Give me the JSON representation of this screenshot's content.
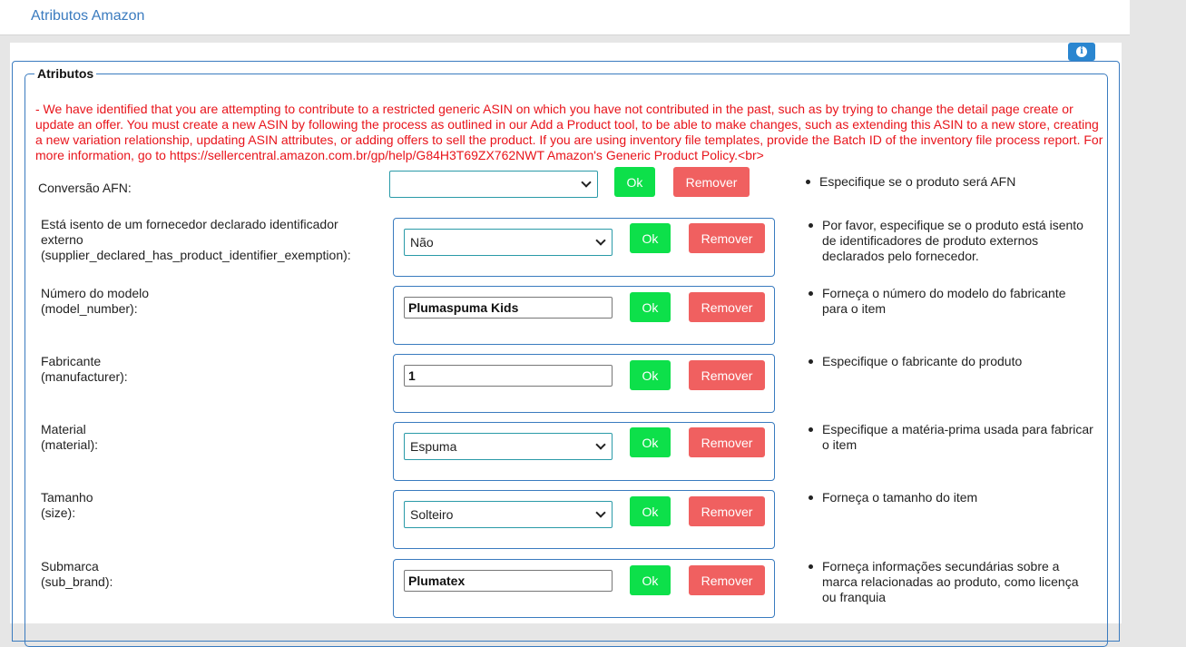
{
  "header": {
    "title": "Atributos Amazon"
  },
  "icons": {
    "info": "info-icon",
    "dropdown": "chevron-down-icon"
  },
  "colors": {
    "accent": "#3a7bbf",
    "error": "#e8141b",
    "ok": "#0de04a",
    "remove": "#f06060"
  },
  "attributes": {
    "legend": "Atributos",
    "error_message": "- We have identified that you are attempting to contribute to a restricted generic ASIN on which you have not contributed in the past, such as by trying to change the detail page create or update an offer. You must create a new ASIN by following the process as outlined in our Add a Product tool, to be able to make changes, such as extending this ASIN to a new store, creating a new variation relationship, updating ASIN attributes, or adding offers to sell the product. If you are using inventory file templates, provide the Batch ID of the inventory file process report. For more information, go to https://sellercentral.amazon.com.br/gp/help/G84H3T69ZX762NWT Amazon's Generic Product Policy.<br>",
    "ok_label": "Ok",
    "remove_label": "Remover",
    "rows": [
      {
        "label": "Conversão AFN:",
        "label_code": "",
        "type": "select",
        "value": "",
        "help": "Especifique se o produto será AFN"
      },
      {
        "label": "Está isento de um fornecedor declarado identificador externo",
        "label_code": "(supplier_declared_has_product_identifier_exemption):",
        "type": "select",
        "value": "Não",
        "help": "Por favor, especifique se o produto está isento de identificadores de produto externos declarados pelo fornecedor."
      },
      {
        "label": "Número do modelo",
        "label_code": "(model_number):",
        "type": "input",
        "value": "Plumaspuma Kids",
        "help": "Forneça o número do modelo do fabricante para o item"
      },
      {
        "label": "Fabricante",
        "label_code": "(manufacturer):",
        "type": "input",
        "value": "1",
        "help": "Especifique o fabricante do produto"
      },
      {
        "label": "Material",
        "label_code": "(material):",
        "type": "select",
        "value": "Espuma",
        "help": "Especifique a matéria-prima usada para fabricar o item"
      },
      {
        "label": "Tamanho",
        "label_code": "(size):",
        "type": "select",
        "value": "Solteiro",
        "help": "Forneça o tamanho do item"
      },
      {
        "label": "Submarca",
        "label_code": "(sub_brand):",
        "type": "input",
        "value": "Plumatex",
        "help": "Forneça informações secundárias sobre a marca relacionadas ao produto, como licença ou franquia"
      }
    ]
  }
}
